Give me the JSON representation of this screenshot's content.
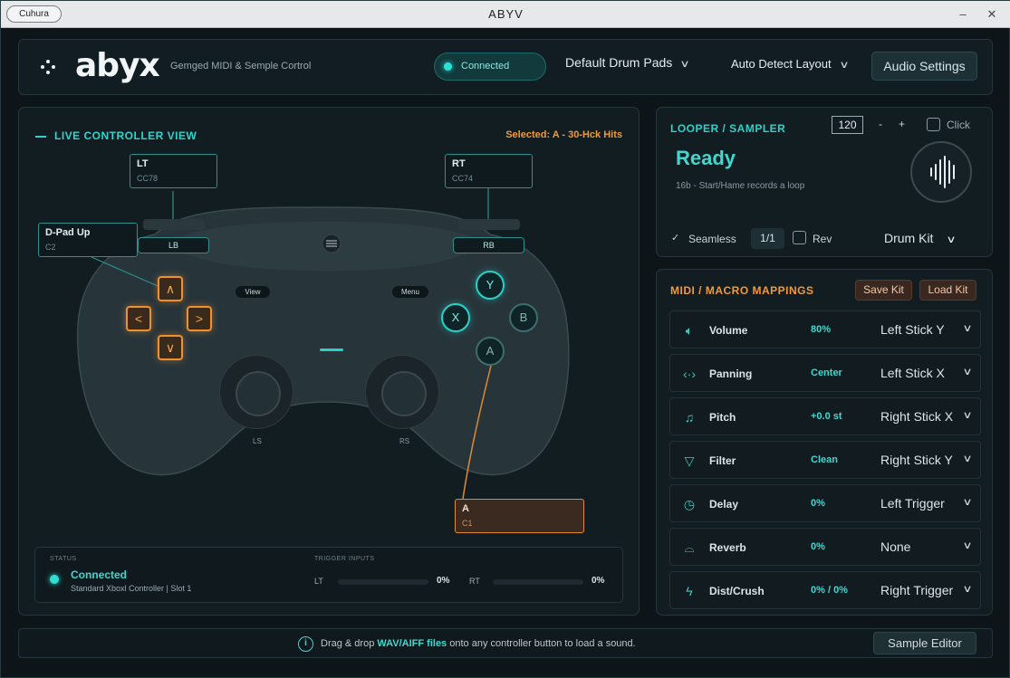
{
  "window": {
    "title": "ABYV",
    "left_button": "Cuhura"
  },
  "header": {
    "logo": "abyx",
    "tagline": "Gemged MIDI & Semple Cortrol",
    "connection_status": "Connected",
    "drum_pads_dropdown": "Default Drum Pads",
    "layout_dropdown": "Auto Detect Layout",
    "audio_settings": "Audio Settings"
  },
  "live_view": {
    "title": "LIVE CONTROLLER VIEW",
    "selected": "Selected: A - 30-Hck Hits",
    "callouts": {
      "lt": {
        "name": "LT",
        "sub": "CC78"
      },
      "rt": {
        "name": "RT",
        "sub": "CC74"
      },
      "dpad_up": {
        "name": "D-Pad Up",
        "sub": "C2"
      },
      "a": {
        "name": "A",
        "sub": "C1"
      }
    },
    "bumpers": {
      "lb": "LB",
      "rb": "RB"
    },
    "view_label": "View",
    "menu_label": "Menu",
    "face_buttons": {
      "y": "Y",
      "x": "X",
      "b": "B",
      "a": "A"
    },
    "stick_labels": {
      "left": "LS",
      "right": "RS"
    },
    "status": {
      "header": "STATUS",
      "state": "Connected",
      "detail": "Standard Xboxl Controller | Slot 1"
    },
    "trigger_inputs": {
      "header": "TRIGGER INPUTS",
      "lt_label": "LT",
      "lt_value": "0%",
      "rt_label": "RT",
      "rt_value": "0%",
      "lt_level": 0,
      "rt_level": 0
    }
  },
  "looper": {
    "title": "LOOPER / SAMPLER",
    "bpm": "120",
    "minus": "-",
    "plus": "+",
    "click_label": "Click",
    "status": "Ready",
    "hint": "16b  -  Start/Hame records a loop",
    "seamless_label": "Seamless",
    "ratio": "1/1",
    "rev_label": "Rev",
    "kit_dropdown": "Drum Kit"
  },
  "midi": {
    "title": "MIDI / MACRO MAPPINGS",
    "save_kit": "Save Kit",
    "load_kit": "Load Kit",
    "rows": [
      {
        "icon": "volume-icon",
        "name": "Volume",
        "value": "80%",
        "mapping": "Left Stick Y"
      },
      {
        "icon": "panning-icon",
        "name": "Panning",
        "value": "Center",
        "mapping": "Left Stick X"
      },
      {
        "icon": "pitch-icon",
        "name": "Pitch",
        "value": "+0.0 st",
        "mapping": "Right Stick X"
      },
      {
        "icon": "filter-icon",
        "name": "Filter",
        "value": "Clean",
        "mapping": "Right Stick Y"
      },
      {
        "icon": "delay-icon",
        "name": "Delay",
        "value": "0%",
        "mapping": "Left Trigger"
      },
      {
        "icon": "reverb-icon",
        "name": "Reverb",
        "value": "0%",
        "mapping": "None"
      },
      {
        "icon": "crush-icon",
        "name": "Dist/Crush",
        "value": "0% / 0%",
        "mapping": "Right Trigger"
      }
    ]
  },
  "footer": {
    "hint_pre": "Drag & drop ",
    "hint_highlight": "WAV/AIFF files",
    "hint_post": " onto any controller button to load a sound.",
    "sample_editor": "Sample Editor"
  },
  "colors": {
    "accent_teal": "#2fd0c8",
    "accent_orange": "#f08f2e",
    "background": "#0d1519"
  }
}
